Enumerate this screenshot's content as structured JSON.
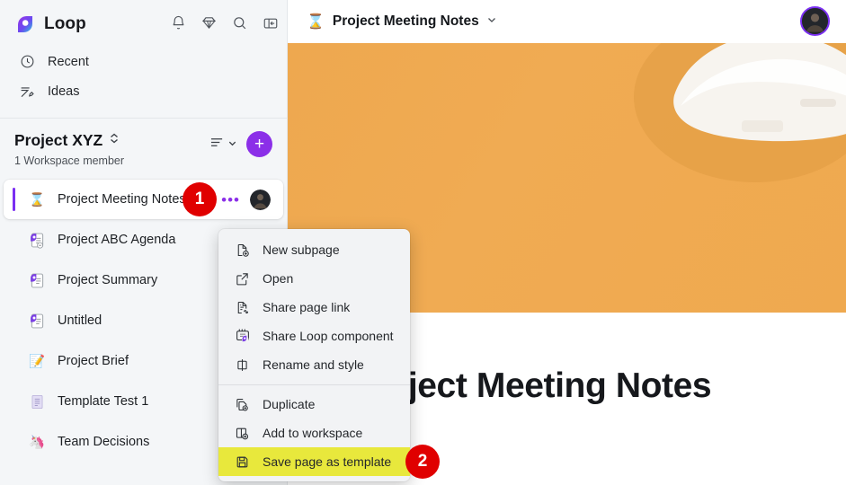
{
  "brand": {
    "name": "Loop",
    "logo_icon": "loop-logo-icon"
  },
  "top_icons": [
    {
      "name": "notifications-icon",
      "glyph": "bell"
    },
    {
      "name": "premium-diamond-icon",
      "glyph": "diamond"
    },
    {
      "name": "search-icon",
      "glyph": "magnifier"
    },
    {
      "name": "collapse-sidebar-icon",
      "glyph": "panel"
    }
  ],
  "nav": [
    {
      "label": "Recent",
      "icon": "clock-icon"
    },
    {
      "label": "Ideas",
      "icon": "pencil-write-icon"
    }
  ],
  "workspace": {
    "title": "Project XYZ",
    "subtitle": "1 Workspace member",
    "expand_icon": "chevron-updown-icon",
    "sort_icon": "sort-lines-icon",
    "sort_chevron_icon": "chevron-down-icon",
    "add_label": "+",
    "add_icon": "plus-icon"
  },
  "pages": [
    {
      "label": "Project Meeting Notes",
      "emoji": "⌛",
      "selected": true,
      "more_label": "•••"
    },
    {
      "label": "Project ABC Agenda",
      "emoji": "",
      "selected": false
    },
    {
      "label": "Project Summary",
      "emoji": "",
      "selected": false
    },
    {
      "label": "Untitled",
      "emoji": "",
      "selected": false
    },
    {
      "label": "Project Brief",
      "emoji": "📝",
      "selected": false
    },
    {
      "label": "Template Test 1",
      "emoji": "📄",
      "selected": false
    },
    {
      "label": "Team Decisions",
      "emoji": "🦄",
      "selected": false
    }
  ],
  "topbar": {
    "emoji": "⌛",
    "title": "Project Meeting Notes",
    "chevron_icon": "chevron-down-icon",
    "avatar_icon": "user-avatar"
  },
  "page": {
    "title": "Project Meeting Notes",
    "banner_icon": "hard-hat-house-banner-image"
  },
  "context_menu": {
    "group1": [
      {
        "label": "New subpage",
        "icon": "new-subpage-icon"
      },
      {
        "label": "Open",
        "icon": "open-external-icon"
      },
      {
        "label": "Share page link",
        "icon": "share-page-link-icon"
      },
      {
        "label": "Share Loop component",
        "icon": "share-loop-component-icon"
      },
      {
        "label": "Rename and style",
        "icon": "rename-style-icon"
      }
    ],
    "group2": [
      {
        "label": "Duplicate",
        "icon": "duplicate-icon",
        "highlighted": false
      },
      {
        "label": "Add to workspace",
        "icon": "add-to-workspace-icon",
        "highlighted": false
      },
      {
        "label": "Save page as template",
        "icon": "save-floppy-icon",
        "highlighted": true
      }
    ]
  },
  "annotations": [
    {
      "number": "1"
    },
    {
      "number": "2"
    }
  ],
  "colors": {
    "accent_purple": "#8b2fe8",
    "badge_red": "#e00000",
    "highlight_yellow": "#e8e83c",
    "banner_orange": "#efa94f",
    "sidebar_bg": "#f4f6f8"
  }
}
